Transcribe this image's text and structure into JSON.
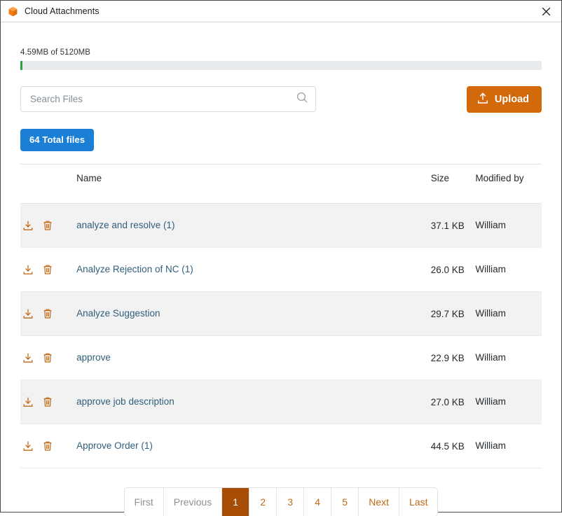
{
  "window": {
    "title": "Cloud Attachments",
    "app_icon": "cube-icon",
    "close_icon": "close-icon"
  },
  "storage": {
    "label": "4.59MB of 5120MB",
    "used_mb": 4.59,
    "total_mb": 5120,
    "percent": 0.09,
    "fill_color": "#2e9e43",
    "track_color": "#e8ebed"
  },
  "search": {
    "placeholder": "Search Files",
    "value": "",
    "icon": "search-icon"
  },
  "upload": {
    "label": "Upload",
    "icon": "upload-icon",
    "color": "#d2690b"
  },
  "badge": {
    "label": "64 Total files",
    "color": "#1c7fd6"
  },
  "table": {
    "headers": {
      "actions": "",
      "name": "Name",
      "size": "Size",
      "modified_by": "Modified by"
    },
    "rows": [
      {
        "name": "analyze and resolve (1)",
        "size": "37.1 KB",
        "modified_by": "William"
      },
      {
        "name": "Analyze Rejection of NC (1)",
        "size": "26.0 KB",
        "modified_by": "William"
      },
      {
        "name": "Analyze Suggestion",
        "size": "29.7 KB",
        "modified_by": "William"
      },
      {
        "name": "approve",
        "size": "22.9 KB",
        "modified_by": "William"
      },
      {
        "name": "approve job description",
        "size": "27.0 KB",
        "modified_by": "William"
      },
      {
        "name": "Approve Order (1)",
        "size": "44.5 KB",
        "modified_by": "William"
      }
    ],
    "row_icons": {
      "download": "download-icon",
      "delete": "trash-icon"
    }
  },
  "pagination": {
    "first": "First",
    "previous": "Previous",
    "pages": [
      "1",
      "2",
      "3",
      "4",
      "5"
    ],
    "next": "Next",
    "last": "Last",
    "active_page": "1",
    "active_color": "#a84d05",
    "link_color": "#c06a16",
    "disabled_color": "#8c9196"
  }
}
